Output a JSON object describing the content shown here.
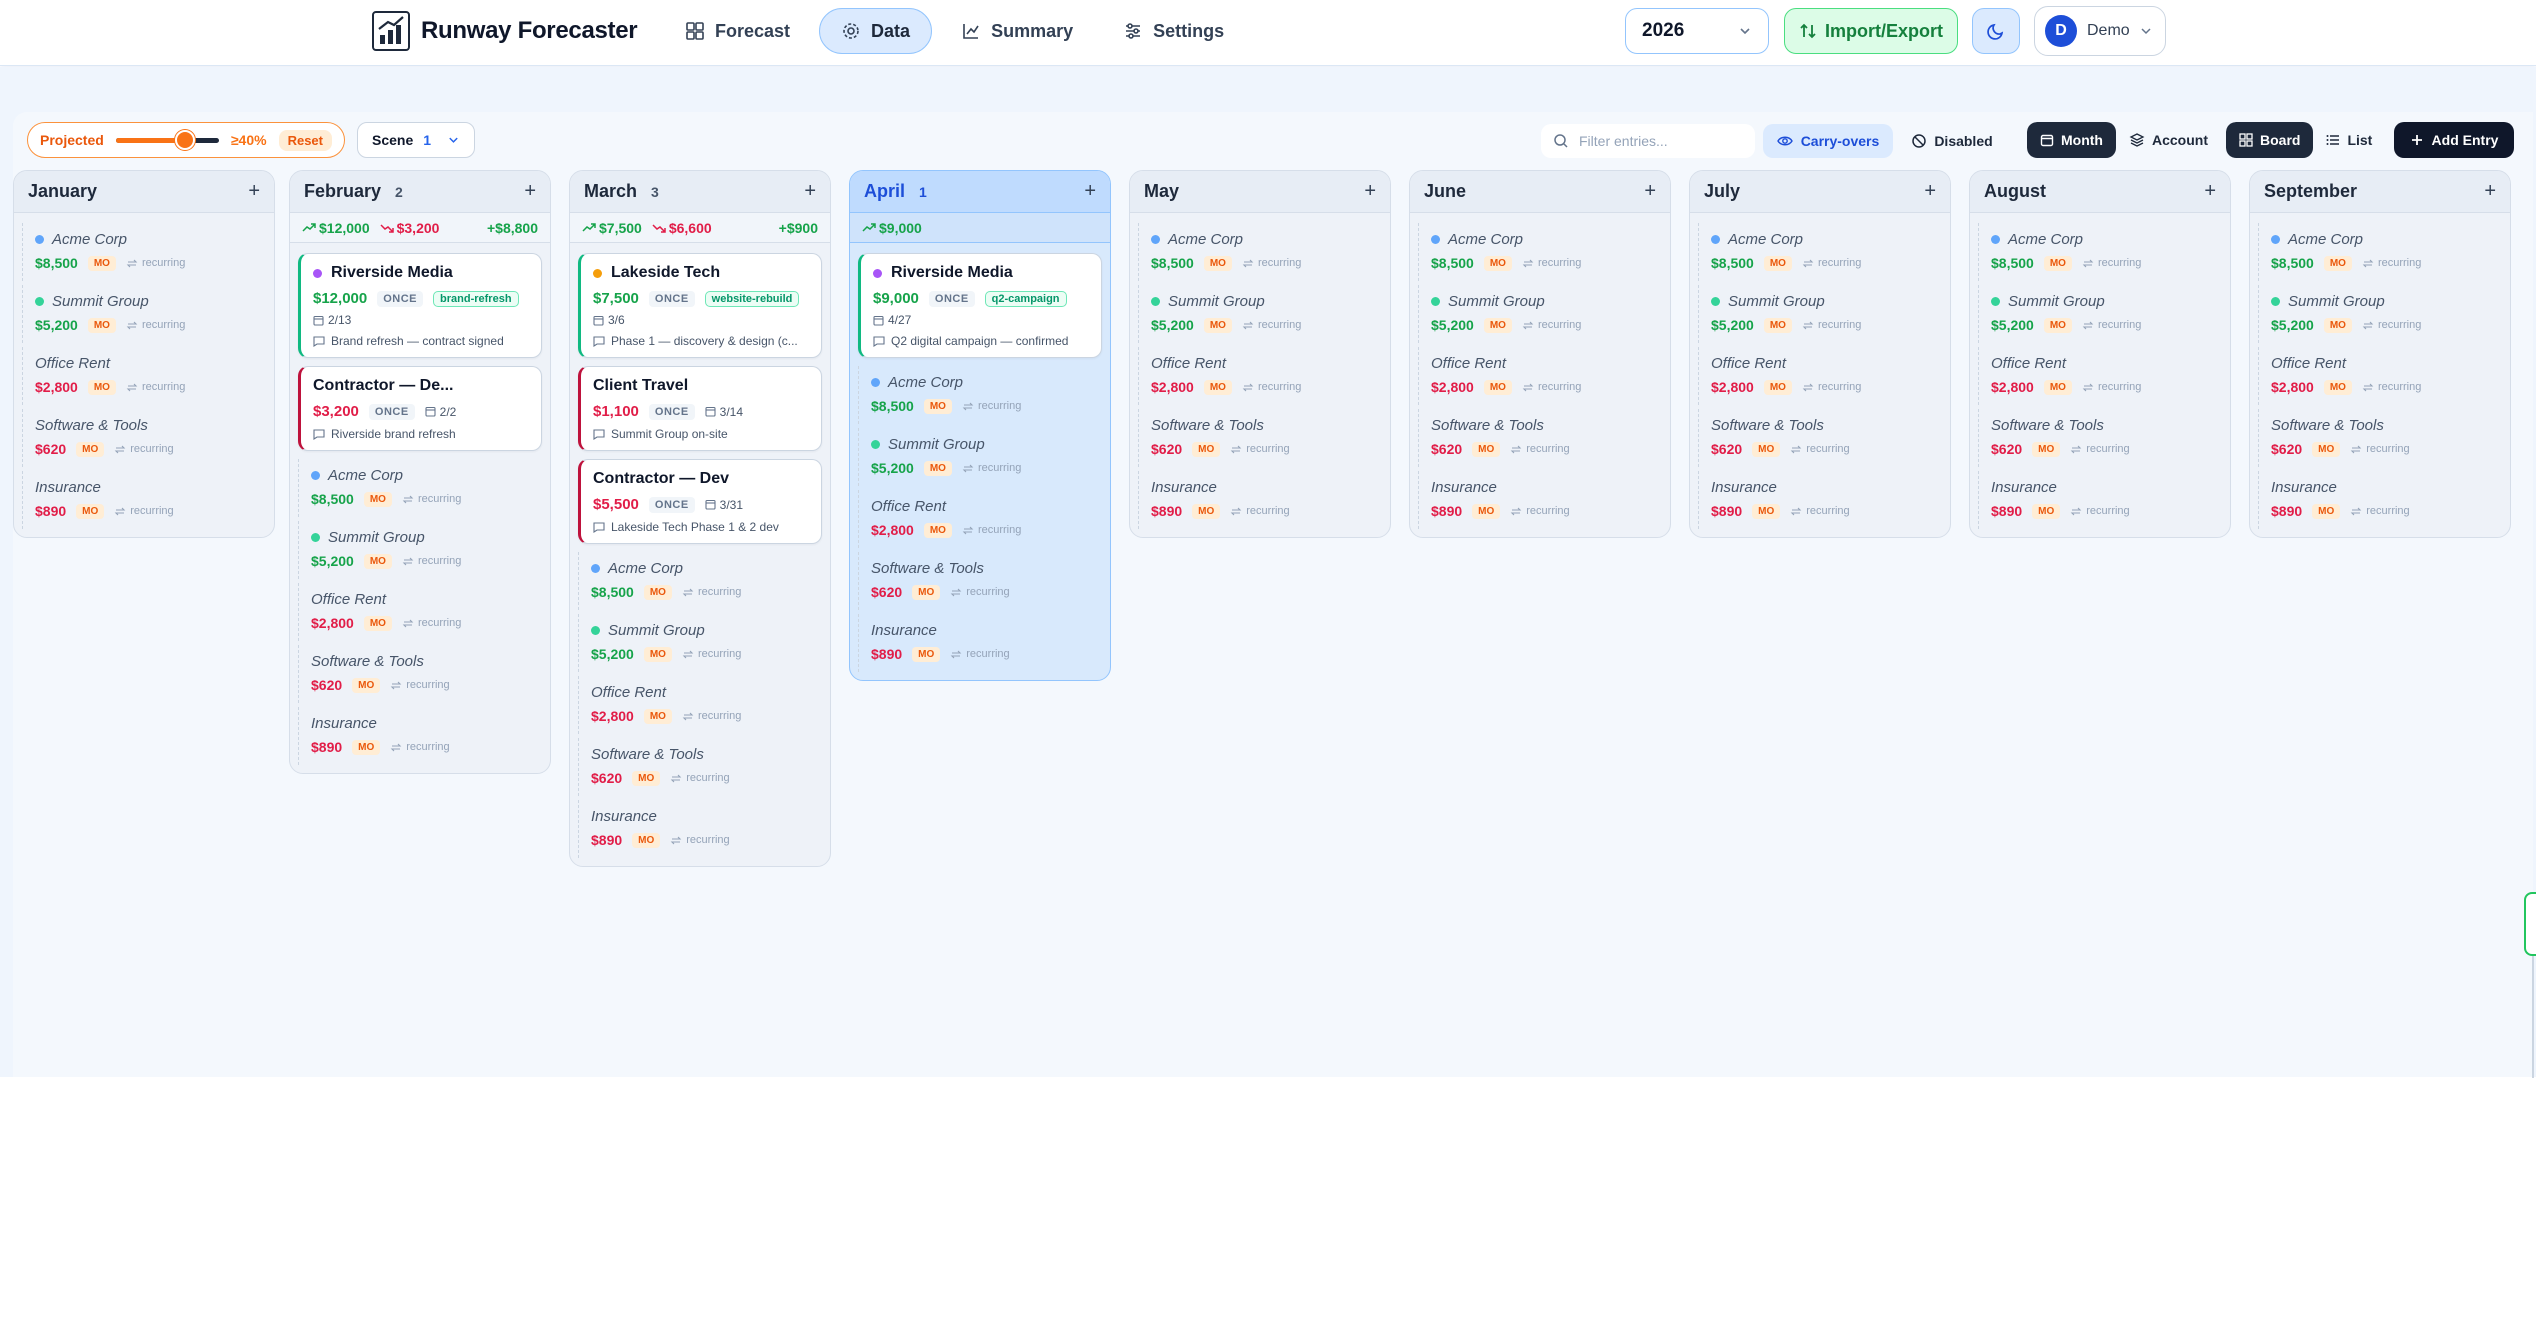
{
  "app": {
    "name": "Runway Forecaster"
  },
  "nav": [
    {
      "label": "Forecast",
      "icon": "grid-icon",
      "active": false
    },
    {
      "label": "Data",
      "icon": "gear-icon",
      "active": true
    },
    {
      "label": "Summary",
      "icon": "chart-line-icon",
      "active": false
    },
    {
      "label": "Settings",
      "icon": "sliders-icon",
      "active": false
    }
  ],
  "header": {
    "year": "2026",
    "import_label": "Import/Export",
    "user_initial": "D",
    "user_name": "Demo"
  },
  "toolbar": {
    "projected_label": "Projected",
    "projected_threshold": "≥40%",
    "projected_slider_fraction": 0.62,
    "reset_label": "Reset",
    "scene_label": "Scene",
    "scene_value": "1",
    "filter_placeholder": "Filter entries...",
    "carry_label": "Carry-overs",
    "disabled_label": "Disabled",
    "month_label": "Month",
    "account_label": "Account",
    "board_label": "Board",
    "list_label": "List",
    "add_label": "Add Entry"
  },
  "recurring_label": "recurring",
  "mo_label": "MO",
  "once_label": "ONCE",
  "recurring_items": [
    {
      "name": "Acme Corp",
      "amount": "$8,500",
      "type": "in",
      "color": "#60a5fa"
    },
    {
      "name": "Summit Group",
      "amount": "$5,200",
      "type": "in",
      "color": "#34d399"
    },
    {
      "name": "Office Rent",
      "amount": "$2,800",
      "type": "out",
      "color": ""
    },
    {
      "name": "Software & Tools",
      "amount": "$620",
      "type": "out",
      "color": ""
    },
    {
      "name": "Insurance",
      "amount": "$890",
      "type": "out",
      "color": ""
    }
  ],
  "months": [
    {
      "name": "January",
      "count": "",
      "current": false,
      "summary": null,
      "cards": []
    },
    {
      "name": "February",
      "count": "2",
      "current": false,
      "summary": {
        "in": "$12,000",
        "out": "$3,200",
        "net": "+$8,800"
      },
      "cards": [
        {
          "name": "Riverside Media",
          "amount": "$12,000",
          "type": "in",
          "color": "#a855f7",
          "tag": "brand-refresh",
          "date": "2/13",
          "note": "Brand refresh — contract signed"
        },
        {
          "name": "Contractor — De...",
          "amount": "$3,200",
          "type": "out",
          "color": "",
          "tag": "",
          "date": "2/2",
          "note": "Riverside brand refresh"
        }
      ]
    },
    {
      "name": "March",
      "count": "3",
      "current": false,
      "summary": {
        "in": "$7,500",
        "out": "$6,600",
        "net": "+$900"
      },
      "cards": [
        {
          "name": "Lakeside Tech",
          "amount": "$7,500",
          "type": "in",
          "color": "#f59e0b",
          "tag": "website-rebuild",
          "date": "3/6",
          "note": "Phase 1 — discovery & design (c..."
        },
        {
          "name": "Client Travel",
          "amount": "$1,100",
          "type": "out",
          "color": "",
          "tag": "",
          "date": "3/14",
          "note": "Summit Group on-site"
        },
        {
          "name": "Contractor — Dev",
          "amount": "$5,500",
          "type": "out",
          "color": "",
          "tag": "",
          "date": "3/31",
          "note": "Lakeside Tech Phase 1 & 2 dev"
        }
      ]
    },
    {
      "name": "April",
      "count": "1",
      "current": true,
      "summary": {
        "in": "$9,000",
        "out": "",
        "net": ""
      },
      "cards": [
        {
          "name": "Riverside Media",
          "amount": "$9,000",
          "type": "in",
          "color": "#a855f7",
          "tag": "q2-campaign",
          "date": "4/27",
          "note": "Q2 digital campaign — confirmed"
        }
      ]
    },
    {
      "name": "May",
      "count": "",
      "current": false,
      "summary": null,
      "cards": []
    },
    {
      "name": "June",
      "count": "",
      "current": false,
      "summary": null,
      "cards": []
    },
    {
      "name": "July",
      "count": "",
      "current": false,
      "summary": null,
      "cards": []
    },
    {
      "name": "August",
      "count": "",
      "current": false,
      "summary": null,
      "cards": []
    },
    {
      "name": "September",
      "count": "",
      "current": false,
      "summary": null,
      "cards": []
    }
  ]
}
